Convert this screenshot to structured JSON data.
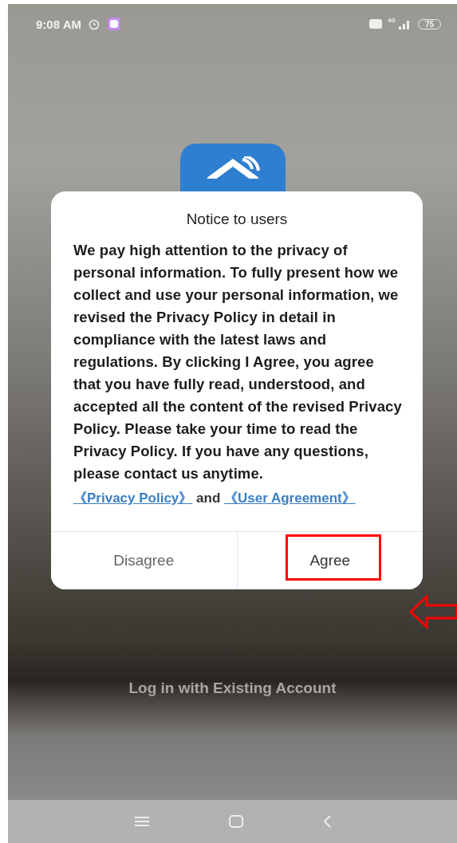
{
  "status_bar": {
    "time": "9:08 AM",
    "network": "4G",
    "battery": "75"
  },
  "dialog": {
    "title": "Notice to users",
    "body": "We pay high attention to the privacy of personal information. To fully present how we collect and use your personal information, we revised the Privacy Policy in detail in compliance with the latest laws and regulations. By clicking I Agree, you agree that you have fully read, understood, and accepted all the content of the revised Privacy Policy. Please take your time to read the Privacy Policy. If you have any questions, please contact us anytime.",
    "links_line": [
      {
        "kind": "link",
        "text": "《Privacy Policy》"
      },
      {
        "kind": "text",
        "text": "and"
      },
      {
        "kind": "link",
        "text": "《User Agreement》"
      }
    ],
    "buttons": [
      {
        "label": "Disagree",
        "highlighted": false
      },
      {
        "label": "Agree",
        "highlighted": true
      }
    ]
  },
  "login_link": "Log in with Existing Account"
}
